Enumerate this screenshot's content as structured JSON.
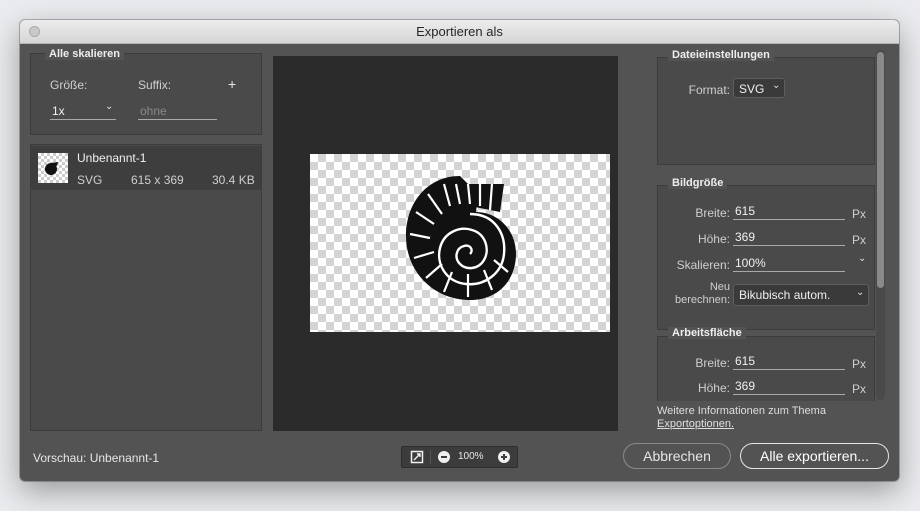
{
  "window": {
    "title": "Exportieren als"
  },
  "scale_section": {
    "title": "Alle skalieren",
    "size_label": "Größe:",
    "suffix_label": "Suffix:",
    "add_symbol": "+",
    "size_value": "1x",
    "suffix_placeholder": "ohne"
  },
  "asset": {
    "name": "Unbenannt-1",
    "format": "SVG",
    "dimensions": "615 x 369",
    "filesize": "30.4 KB"
  },
  "file_settings": {
    "title": "Dateieinstellungen",
    "format_label": "Format:",
    "format_value": "SVG"
  },
  "image_size": {
    "title": "Bildgröße",
    "width_label": "Breite:",
    "width_value": "615",
    "height_label": "Höhe:",
    "height_value": "369",
    "scale_label": "Skalieren:",
    "scale_value": "100%",
    "resample_label_line1": "Neu",
    "resample_label_line2": "berechnen:",
    "resample_value": "Bikubisch autom.",
    "unit": "Px"
  },
  "artboard": {
    "title": "Arbeitsfläche",
    "width_label": "Breite:",
    "width_value": "615",
    "height_label": "Höhe:",
    "height_value": "369",
    "unit": "Px"
  },
  "info": {
    "text": "Weitere Informationen zum Thema",
    "link": "Exportoptionen."
  },
  "footer": {
    "preview_label": "Vorschau: Unbenannt-1",
    "zoom": "100%",
    "cancel": "Abbrechen",
    "export": "Alle exportieren..."
  },
  "icons": {
    "fit": "fit-to-screen-icon",
    "zoom_out": "zoom-out-icon",
    "zoom_in": "zoom-in-icon",
    "chevron": "chevron-down-icon",
    "preview_art": "nautilus-shell-icon"
  },
  "colors": {
    "window_bg": "#535353",
    "panel_bg": "#4a4a4a",
    "canvas_bg": "#2b2b2b",
    "selected_row": "#3e3e3e",
    "link": "#e0e0e0"
  }
}
